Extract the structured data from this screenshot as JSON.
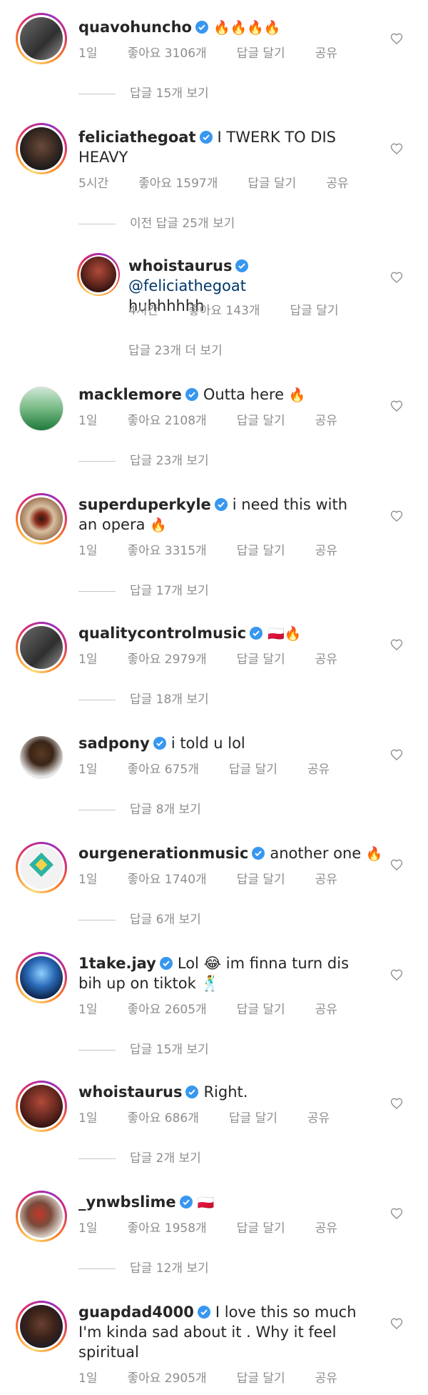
{
  "labels": {
    "like": "좋아요",
    "reply": "답글 달기",
    "share": "공유"
  },
  "comments": [
    {
      "username": "quavohuncho",
      "text": "",
      "emoji": "🔥🔥🔥🔥",
      "time": "1일",
      "likes": "좋아요 3106개",
      "replies": "답글 15개 보기"
    },
    {
      "username": "feliciathegoat",
      "text": "I TWERK TO DIS HEAVY",
      "time": "5시간",
      "likes": "좋아요 1597개",
      "replies": "이전 답글 25개 보기"
    },
    {
      "username": "whoistaurus",
      "mention": "@feliciathegoat",
      "text": "huhhhhhh",
      "time": "4시간",
      "likes": "좋아요 143개",
      "replies": "답글 23개 더 보기"
    },
    {
      "username": "macklemore",
      "text": "Outta here",
      "emoji": "🔥",
      "time": "1일",
      "likes": "좋아요 2108개",
      "replies": "답글 23개 보기"
    },
    {
      "username": "superduperkyle",
      "text": "i need this with an opera",
      "emoji": "🔥",
      "time": "1일",
      "likes": "좋아요 3315개",
      "replies": "답글 17개 보기"
    },
    {
      "username": "qualitycontrolmusic",
      "text": "",
      "emoji": "🇵🇱🔥",
      "time": "1일",
      "likes": "좋아요 2979개",
      "replies": "답글 18개 보기"
    },
    {
      "username": "sadpony",
      "text": "i told u lol",
      "time": "1일",
      "likes": "좋아요 675개",
      "replies": "답글 8개 보기"
    },
    {
      "username": "ourgenerationmusic",
      "text": "another one",
      "emoji": "🔥",
      "time": "1일",
      "likes": "좋아요 1740개",
      "replies": "답글 6개 보기"
    },
    {
      "username": "1take.jay",
      "text": "Lol 😂 im finna turn dis bih up on tiktok 🕺",
      "time": "1일",
      "likes": "좋아요 2605개",
      "replies": "답글 15개 보기"
    },
    {
      "username": "whoistaurus",
      "text": "Right.",
      "time": "1일",
      "likes": "좋아요 686개",
      "replies": "답글 2개 보기"
    },
    {
      "username": "_ynwbslime",
      "text": "",
      "emoji": "🇵🇱",
      "time": "1일",
      "likes": "좋아요 1958개",
      "replies": "답글 12개 보기"
    },
    {
      "username": "guapdad4000",
      "text": "I love this so much I'm kinda sad about it . Why it feel spiritual",
      "time": "1일",
      "likes": "좋아요 2905개",
      "replies": ""
    }
  ]
}
